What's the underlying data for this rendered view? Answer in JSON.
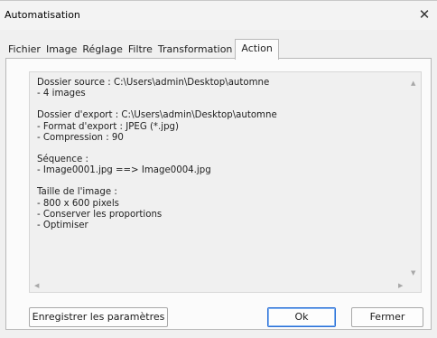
{
  "window": {
    "title": "Automatisation"
  },
  "tabs": [
    {
      "label": "Fichier"
    },
    {
      "label": "Image"
    },
    {
      "label": "Réglage"
    },
    {
      "label": "Filtre"
    },
    {
      "label": "Transformation"
    },
    {
      "label": "Action",
      "active": true
    }
  ],
  "summary": {
    "source_line": "Dossier source : C:\\Users\\admin\\Desktop\\automne",
    "images_line": "- 4 images",
    "export_line": "Dossier d'export : C:\\Users\\admin\\Desktop\\automne",
    "format_line": "- Format d'export : JPEG (*.jpg)",
    "compression_line": "- Compression : 90",
    "sequence_title": "Séquence :",
    "sequence_line": "- Image0001.jpg ==> Image0004.jpg",
    "size_title": "Taille de l'image :",
    "size_line": "- 800 x 600 pixels",
    "ratio_line": "- Conserver les proportions",
    "optimize_line": "- Optimiser"
  },
  "buttons": {
    "save_label": "Enregistrer les paramètres",
    "ok_label": "Ok",
    "close_label": "Fermer"
  },
  "icons": {
    "close": "close-icon",
    "scroll_up": "scroll-up-arrow-icon",
    "scroll_down": "scroll-down-arrow-icon",
    "scroll_left": "scroll-left-arrow-icon",
    "scroll_right": "scroll-right-arrow-icon"
  },
  "colors": {
    "accent": "#2b6fd6"
  }
}
